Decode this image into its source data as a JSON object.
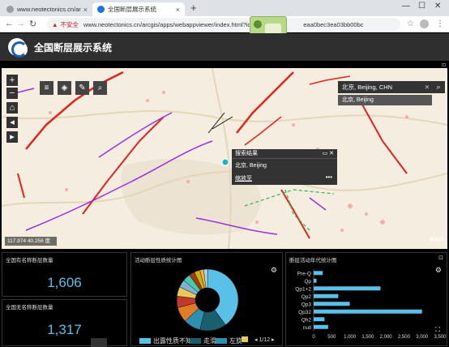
{
  "browser": {
    "tabs": [
      {
        "title": "www.neotectonics.cn/arcgis/p",
        "active": false
      },
      {
        "title": "全国断层展示系统",
        "active": true
      }
    ],
    "new_tab": "+",
    "url_warning": "不安全",
    "url_text": "www.neotectonics.cn/arcgis/apps/webappviewer/index.html?id=3",
    "url_tail": "eaa0bec3ea03bb00bc"
  },
  "app": {
    "title": "全国断层展示系统"
  },
  "map": {
    "zoom_in": "+",
    "zoom_out": "−",
    "search_value": "北京, Beijing, CHN",
    "search_clear": "✕",
    "suggestion": "北京, Beijing",
    "popup_title": "搜索结果",
    "popup_body": "北京, Beijing",
    "popup_zoom": "缩放至",
    "popup_more": "•••",
    "scale_text": "117.974 40.256 度",
    "attribution": "esri"
  },
  "panels": {
    "active_faults_count": {
      "title": "全国有名称断层数量",
      "value": "1,606"
    },
    "unnamed_faults_count": {
      "title": "全国无名称断层数量",
      "value": "1,317"
    },
    "fault_nature": {
      "title": "活动断层性质统计图",
      "legend": [
        {
          "label": "出露性质不知",
          "color": "#5bc0e8"
        },
        {
          "label": "走滑",
          "color": "#1b5e6e"
        },
        {
          "label": "左旋",
          "color": "#2e8fb0"
        },
        {
          "label": "",
          "color": "#e8c85b"
        }
      ],
      "pager": "1/12"
    },
    "fault_age": {
      "title": "断层活动年代统计图"
    }
  },
  "chart_data": [
    {
      "type": "pie",
      "title": "活动断层性质统计图",
      "values": [
        40,
        14,
        9,
        8,
        6,
        5,
        4,
        4,
        3,
        3,
        2,
        2
      ],
      "colors": [
        "#5bc0e8",
        "#1b5e6e",
        "#2e8fb0",
        "#e07b28",
        "#c0392b",
        "#e8c85b",
        "#7fb3d5",
        "#48c9b0",
        "#a04000",
        "#d4ac0d",
        "#f5b041",
        "#aed6f1"
      ]
    },
    {
      "type": "bar",
      "orientation": "horizontal",
      "title": "断层活动年代统计图",
      "categories": [
        "Pre-Q",
        "Qp",
        "Qp1+2",
        "Qp2",
        "Qp3",
        "Qp32",
        "Qh2",
        "null"
      ],
      "values": [
        250,
        80,
        1850,
        680,
        1000,
        3000,
        300,
        400
      ],
      "xlim": [
        0,
        3500
      ],
      "xticks": [
        "0",
        "500",
        "1,000",
        "1,500",
        "2,000",
        "2,500",
        "3,000",
        "3,500"
      ],
      "color": "#5bc0e8"
    }
  ]
}
